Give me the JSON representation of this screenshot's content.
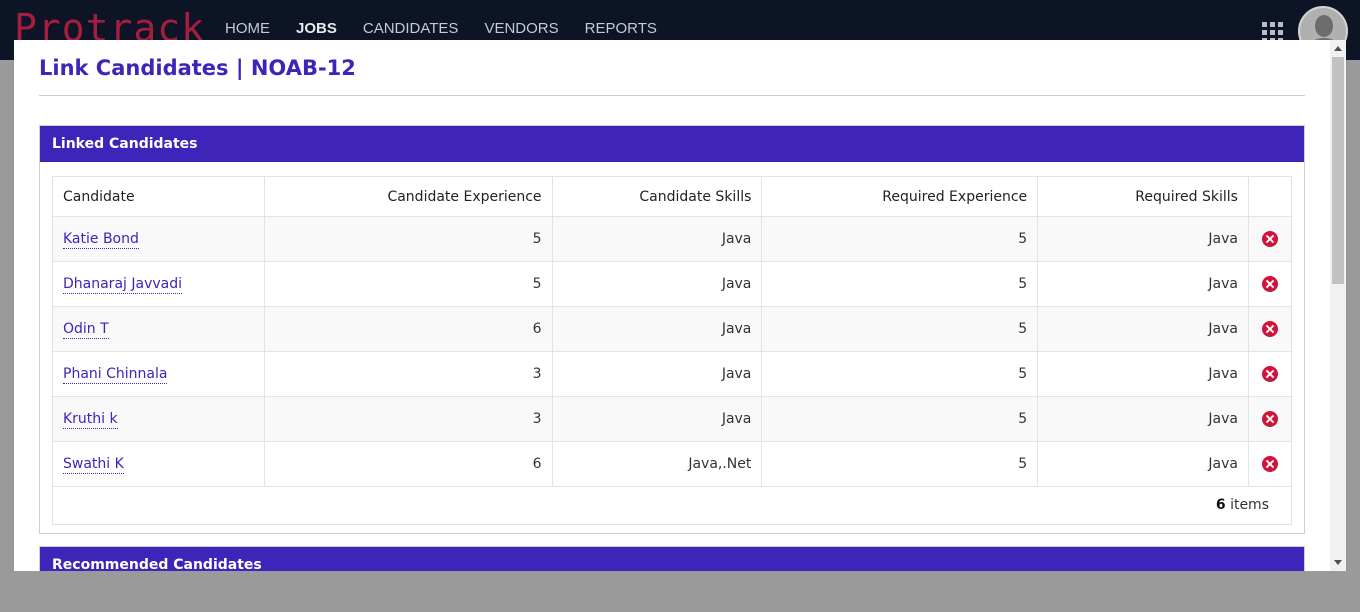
{
  "app": {
    "logo_text": "Protrack"
  },
  "nav": {
    "items": [
      {
        "label": "HOME",
        "active": false
      },
      {
        "label": "JOBS",
        "active": true
      },
      {
        "label": "CANDIDATES",
        "active": false
      },
      {
        "label": "VENDORS",
        "active": false
      },
      {
        "label": "REPORTS",
        "active": false
      }
    ]
  },
  "modal": {
    "title": "Link Candidates | NOAB-12",
    "linked": {
      "header": "Linked Candidates",
      "columns": [
        "Candidate",
        "Candidate Experience",
        "Candidate Skills",
        "Required Experience",
        "Required Skills"
      ],
      "rows": [
        {
          "candidate": "Katie Bond",
          "cand_exp": "5",
          "cand_skills": "Java",
          "req_exp": "5",
          "req_skills": "Java"
        },
        {
          "candidate": "Dhanaraj Javvadi",
          "cand_exp": "5",
          "cand_skills": "Java",
          "req_exp": "5",
          "req_skills": "Java"
        },
        {
          "candidate": "Odin T",
          "cand_exp": "6",
          "cand_skills": "Java",
          "req_exp": "5",
          "req_skills": "Java"
        },
        {
          "candidate": "Phani Chinnala",
          "cand_exp": "3",
          "cand_skills": "Java",
          "req_exp": "5",
          "req_skills": "Java"
        },
        {
          "candidate": "Kruthi k",
          "cand_exp": "3",
          "cand_skills": "Java",
          "req_exp": "5",
          "req_skills": "Java"
        },
        {
          "candidate": "Swathi K",
          "cand_exp": "6",
          "cand_skills": "Java,.Net",
          "req_exp": "5",
          "req_skills": "Java"
        }
      ],
      "footer_count": "6",
      "footer_label": "items"
    },
    "recommended": {
      "header": "Recommended Candidates"
    }
  },
  "colors": {
    "accent": "#3e24b8",
    "navbar": "#0c1426",
    "danger": "#d3123a"
  },
  "icons": {
    "apps": "grid-icon",
    "user": "avatar-icon",
    "remove": "remove-icon"
  }
}
